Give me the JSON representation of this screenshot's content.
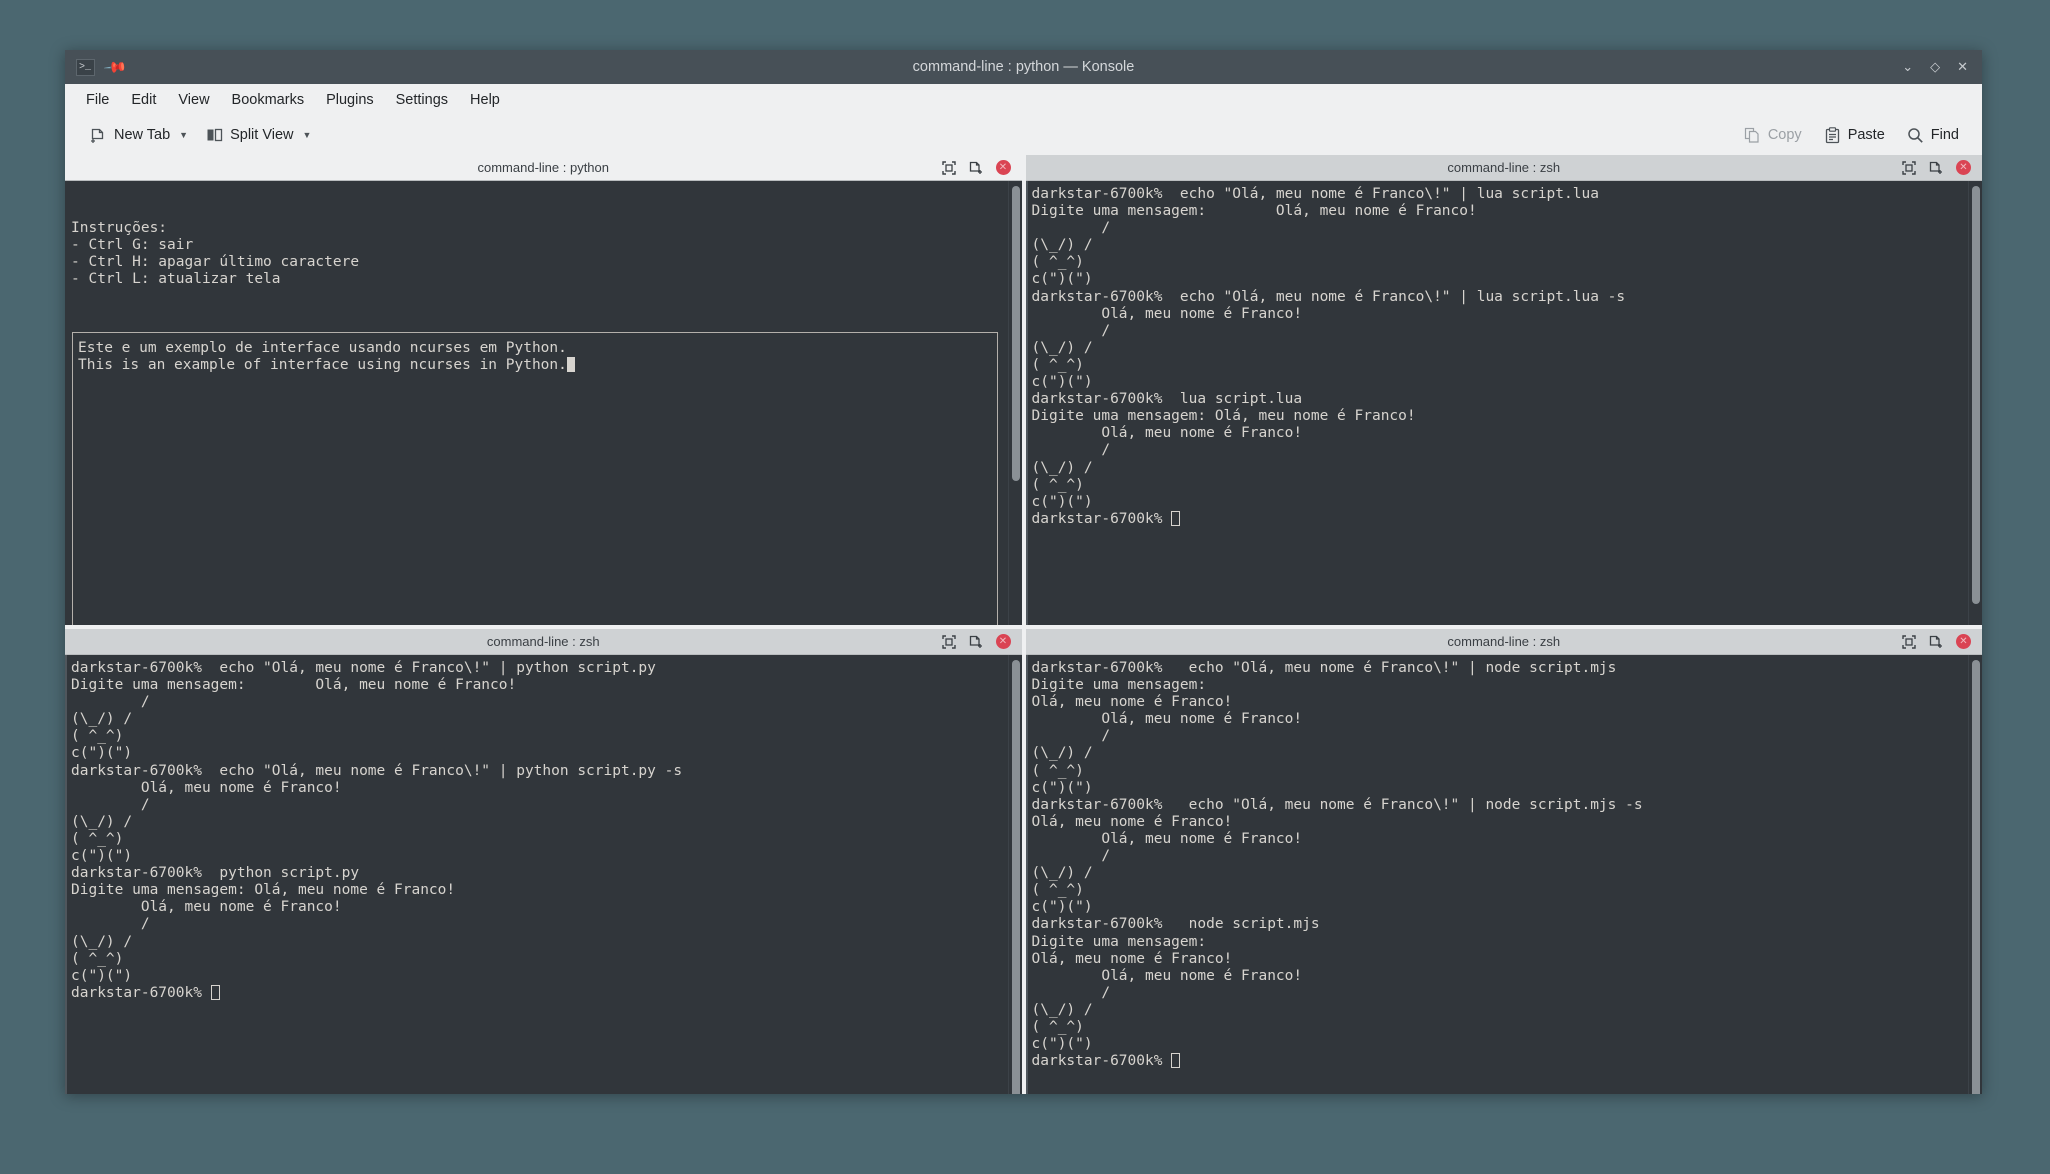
{
  "window": {
    "title": "command-line : python — Konsole",
    "app_icon": "konsole-icon",
    "pin_icon": "pin-icon",
    "controls": [
      {
        "name": "minimize-button",
        "glyph": "⌄"
      },
      {
        "name": "maximize-button",
        "glyph": "◇"
      },
      {
        "name": "close-button",
        "glyph": "✕"
      }
    ]
  },
  "menubar": {
    "items": [
      {
        "label": "File",
        "name": "menu-file"
      },
      {
        "label": "Edit",
        "name": "menu-edit"
      },
      {
        "label": "View",
        "name": "menu-view"
      },
      {
        "label": "Bookmarks",
        "name": "menu-bookmarks"
      },
      {
        "label": "Plugins",
        "name": "menu-plugins"
      },
      {
        "label": "Settings",
        "name": "menu-settings"
      },
      {
        "label": "Help",
        "name": "menu-help"
      }
    ]
  },
  "toolbar": {
    "new_tab_label": "New Tab",
    "split_view_label": "Split View",
    "copy_label": "Copy",
    "copy_disabled": true,
    "paste_label": "Paste",
    "find_label": "Find"
  },
  "pane_header_icons": {
    "expand": "expand-icon",
    "new_tab": "new-tab-icon",
    "close": "close-icon"
  },
  "panes": {
    "top_left": {
      "title": "command-line : python",
      "active": true,
      "kind": "ncurses",
      "instructions": [
        "Instruções:",
        "- Ctrl G: sair",
        "- Ctrl H: apagar último caractere",
        "- Ctrl L: atualizar tela"
      ],
      "box_lines": [
        "Este e um exemplo de interface usando ncurses em Python.",
        "This is an example of interface using ncurses in Python."
      ]
    },
    "top_right": {
      "title": "command-line : zsh",
      "active": false,
      "kind": "shell",
      "lines": [
        "darkstar-6700k%  echo \"Olá, meu nome é Franco\\!\" | lua script.lua",
        "Digite uma mensagem:        Olá, meu nome é Franco!",
        "        /",
        "(\\_/) /",
        "( ^_^)",
        "c(\")(\")",
        "darkstar-6700k%  echo \"Olá, meu nome é Franco\\!\" | lua script.lua -s",
        "        Olá, meu nome é Franco!",
        "        /",
        "(\\_/) /",
        "( ^_^)",
        "c(\")(\")",
        "darkstar-6700k%  lua script.lua",
        "Digite uma mensagem: Olá, meu nome é Franco!",
        "        Olá, meu nome é Franco!",
        "        /",
        "(\\_/) /",
        "( ^_^)",
        "c(\")(\")",
        "darkstar-6700k% "
      ],
      "prompt_cursor": "hollow"
    },
    "bottom_left": {
      "title": "command-line : zsh",
      "active": false,
      "kind": "shell",
      "lines": [
        "darkstar-6700k%  echo \"Olá, meu nome é Franco\\!\" | python script.py",
        "Digite uma mensagem:        Olá, meu nome é Franco!",
        "        /",
        "(\\_/) /",
        "( ^_^)",
        "c(\")(\")",
        "darkstar-6700k%  echo \"Olá, meu nome é Franco\\!\" | python script.py -s",
        "        Olá, meu nome é Franco!",
        "        /",
        "(\\_/) /",
        "( ^_^)",
        "c(\")(\")",
        "darkstar-6700k%  python script.py",
        "Digite uma mensagem: Olá, meu nome é Franco!",
        "        Olá, meu nome é Franco!",
        "        /",
        "(\\_/) /",
        "( ^_^)",
        "c(\")(\")",
        "darkstar-6700k% "
      ],
      "prompt_cursor": "hollow"
    },
    "bottom_right": {
      "title": "command-line : zsh",
      "active": false,
      "kind": "shell",
      "lines": [
        "darkstar-6700k%   echo \"Olá, meu nome é Franco\\!\" | node script.mjs",
        "Digite uma mensagem:",
        "Olá, meu nome é Franco!",
        "        Olá, meu nome é Franco!",
        "        /",
        "(\\_/) /",
        "( ^_^)",
        "c(\")(\")",
        "darkstar-6700k%   echo \"Olá, meu nome é Franco\\!\" | node script.mjs -s",
        "Olá, meu nome é Franco!",
        "        Olá, meu nome é Franco!",
        "        /",
        "(\\_/) /",
        "( ^_^)",
        "c(\")(\")",
        "darkstar-6700k%   node script.mjs",
        "Digite uma mensagem:",
        "Olá, meu nome é Franco!",
        "        Olá, meu nome é Franco!",
        "        /",
        "(\\_/) /",
        "( ^_^)",
        "c(\")(\")",
        "darkstar-6700k% "
      ],
      "prompt_cursor": "hollow"
    }
  },
  "colors": {
    "desktop": "#4b6770",
    "window_bg": "#eff0f1",
    "titlebar": "#475057",
    "terminal_bg": "#31363b",
    "terminal_fg": "#d7d4cf",
    "close_red": "#da4453",
    "pane_header_inactive": "#cfd2d4"
  }
}
